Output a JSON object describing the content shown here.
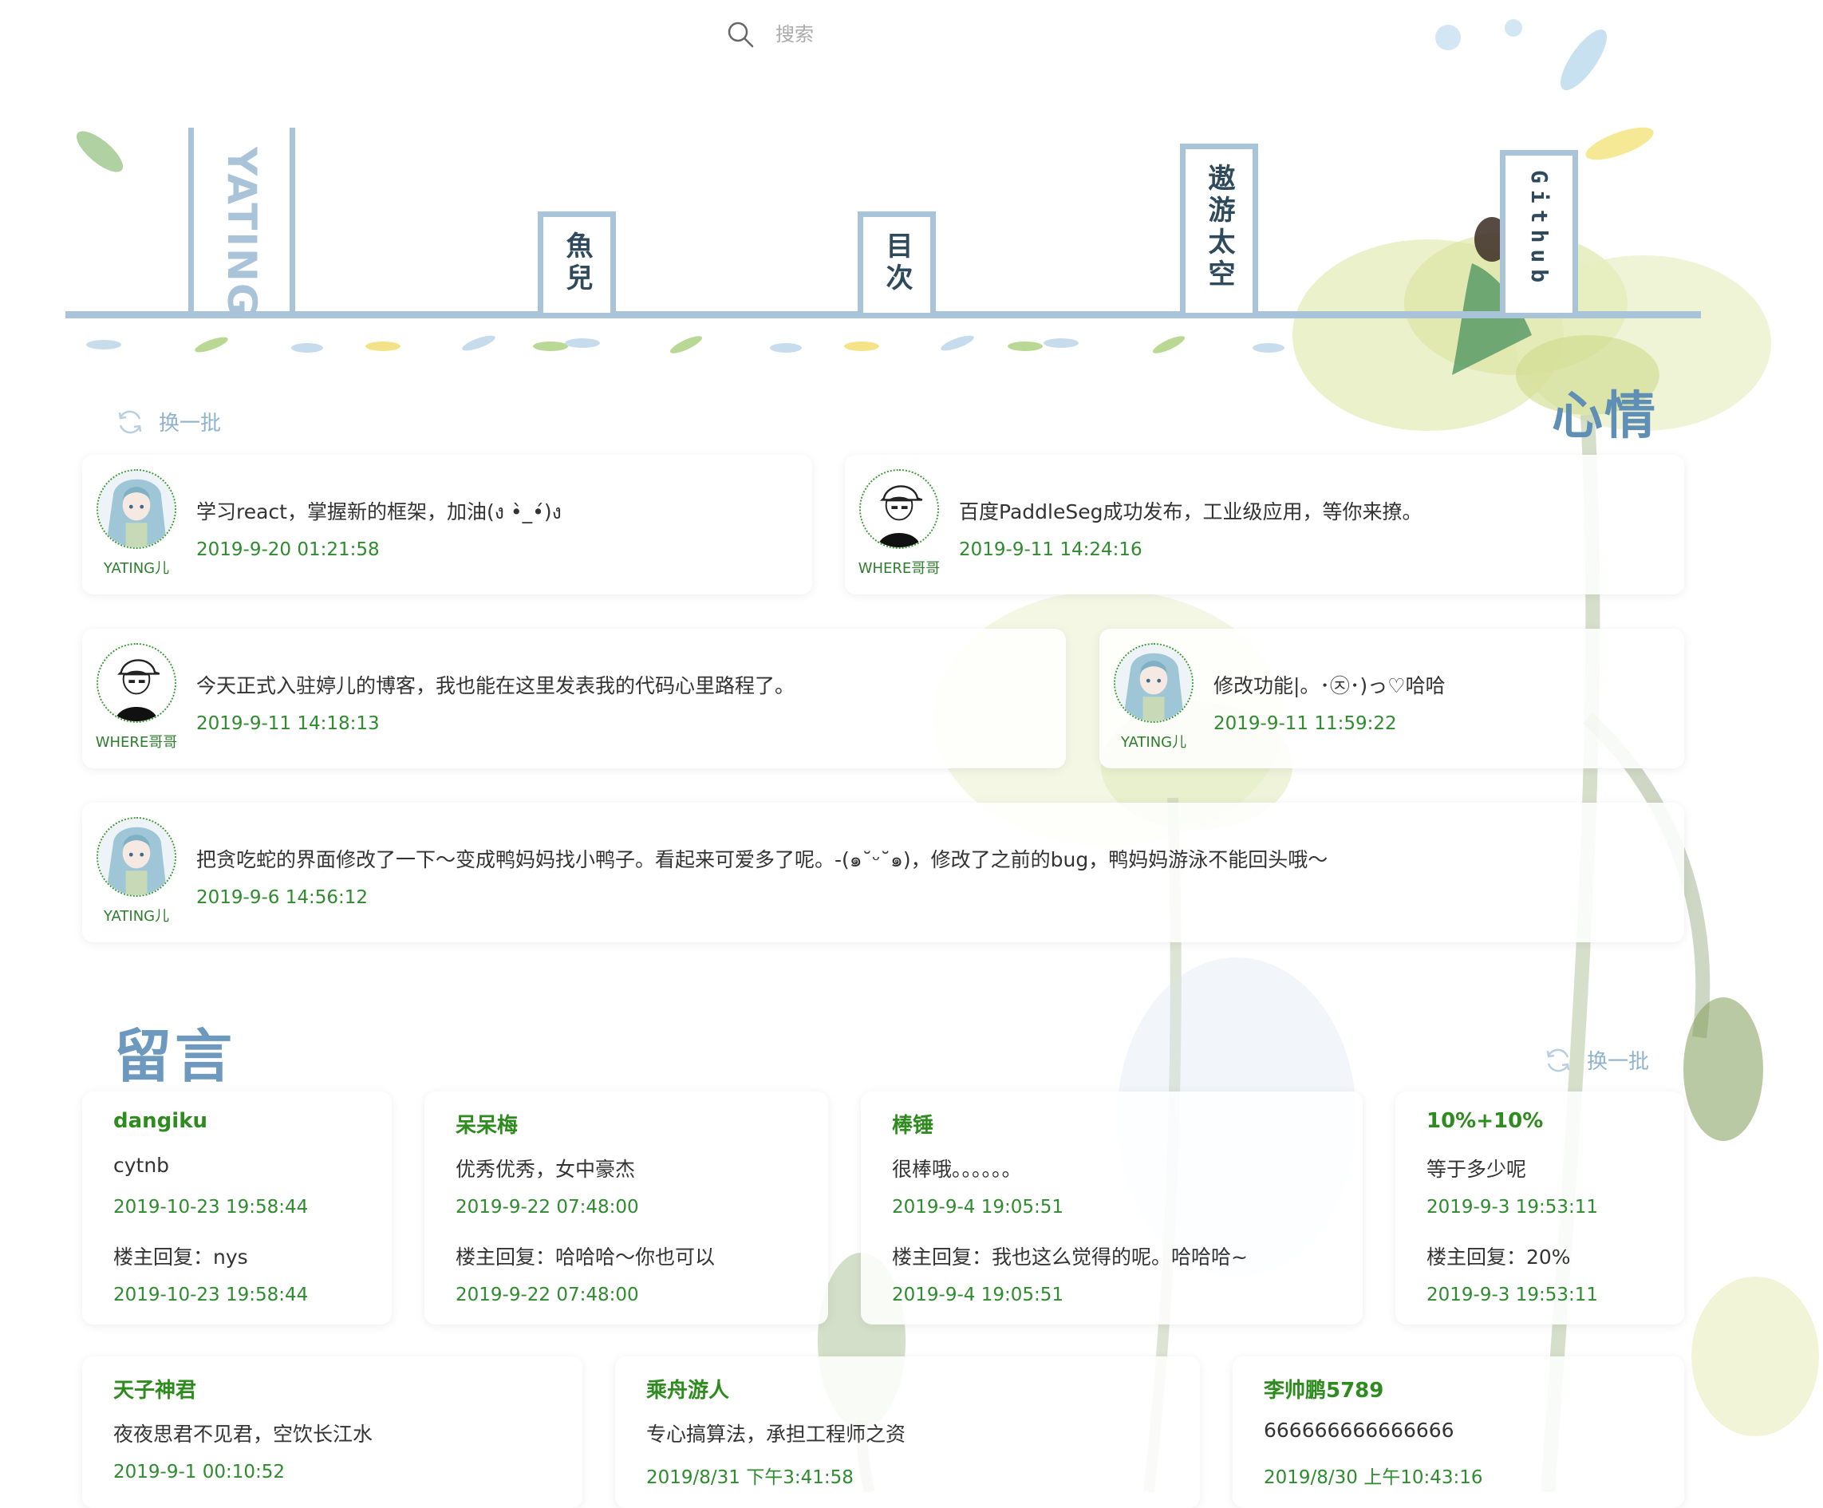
{
  "search": {
    "placeholder": "搜索",
    "icon": "search-icon"
  },
  "nav": {
    "brand": "YATING",
    "tabs": [
      {
        "label": "魚兒"
      },
      {
        "label": "目次"
      },
      {
        "label": "遨游太空"
      },
      {
        "label": "Github"
      }
    ]
  },
  "mood": {
    "title": "心情",
    "refresh_label": "换一批",
    "cards": [
      {
        "user": "YATING儿",
        "avatar": "anime-girl-avatar",
        "text": "学习react，掌握新的框架，加油(ง •̀_•́)ง",
        "time": "2019-9-20 01:21:58"
      },
      {
        "user": "WHERE哥哥",
        "avatar": "boy-cap-avatar",
        "text": "百度PaddleSeg成功发布，工业级应用，等你来撩。",
        "time": "2019-9-11 14:24:16"
      },
      {
        "user": "WHERE哥哥",
        "avatar": "boy-cap-avatar",
        "text": "今天正式入驻婷儿的博客，我也能在这里发表我的代码心里路程了。",
        "time": "2019-9-11 14:18:13"
      },
      {
        "user": "YATING儿",
        "avatar": "anime-girl-avatar",
        "text": "修改功能|。･㉨･)っ♡哈哈",
        "time": "2019-9-11 11:59:22"
      },
      {
        "user": "YATING儿",
        "avatar": "anime-girl-avatar",
        "text": "把贪吃蛇的界面修改了一下～变成鸭妈妈找小鸭子。看起来可爱多了呢。-(๑˘ᵕ˘๑)，修改了之前的bug，鸭妈妈游泳不能回头哦～",
        "time": "2019-9-6 14:56:12"
      }
    ]
  },
  "messages": {
    "title": "留言",
    "refresh_label": "换一批",
    "cards": [
      {
        "name": "dangiku",
        "content": "cytnb",
        "time": "2019-10-23 19:58:44",
        "reply": "楼主回复：nys",
        "reply_time": "2019-10-23 19:58:44"
      },
      {
        "name": "呆呆梅",
        "content": "优秀优秀，女中豪杰",
        "time": "2019-9-22 07:48:00",
        "reply": "楼主回复：哈哈哈～你也可以",
        "reply_time": "2019-9-22 07:48:00"
      },
      {
        "name": "棒锤",
        "content": "很棒哦。。。。。。",
        "time": "2019-9-4 19:05:51",
        "reply": "楼主回复：我也这么觉得的呢。哈哈哈~",
        "reply_time": "2019-9-4 19:05:51"
      },
      {
        "name": "10%+10%",
        "content": "等于多少呢",
        "time": "2019-9-3 19:53:11",
        "reply": "楼主回复：20%",
        "reply_time": "2019-9-3 19:53:11"
      },
      {
        "name": "天子神君",
        "content": "夜夜思君不见君，空饮长江水",
        "time": "2019-9-1 00:10:52"
      },
      {
        "name": "乘舟游人",
        "content": "专心搞算法，承担工程师之资",
        "time": "2019/8/31 下午3:41:58"
      },
      {
        "name": "李帅鹏5789",
        "content": "666666666666666",
        "time": "2019/8/30 上午10:43:16"
      }
    ]
  },
  "colors": {
    "accent": "#a9c3d8",
    "green": "#2e8b2e",
    "title_blue": "#6c99bd"
  }
}
